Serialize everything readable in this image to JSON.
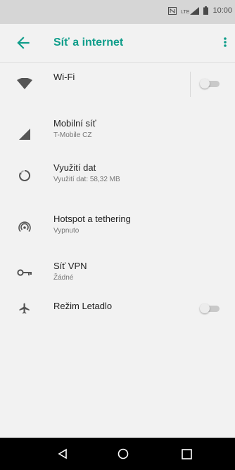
{
  "status_bar": {
    "time": "10:00",
    "lte_label": "LTE",
    "icons": [
      "nfc-icon",
      "lte-signal-icon",
      "battery-icon"
    ]
  },
  "header": {
    "title": "Síť a internet",
    "back_icon": "arrow-left-icon",
    "menu_icon": "more-vert-icon"
  },
  "items": [
    {
      "label": "Wi-Fi",
      "icon": "wifi-icon",
      "toggle": "off"
    },
    {
      "label": "Mobilní síť",
      "sublabel": "T-Mobile CZ",
      "icon": "cell-signal-icon"
    },
    {
      "label": "Využití dat",
      "sublabel": "Využití dat: 58,32 MB",
      "icon": "data-usage-icon"
    },
    {
      "label": "Hotspot a tethering",
      "sublabel": "Vypnuto",
      "icon": "hotspot-icon"
    },
    {
      "label": "Síť VPN",
      "sublabel": "Žádné",
      "icon": "vpn-key-icon"
    },
    {
      "label": "Režim Letadlo",
      "icon": "airplane-icon",
      "toggle": "off"
    }
  ],
  "nav": {
    "back_icon": "nav-back-icon",
    "home_icon": "nav-home-icon",
    "recents_icon": "nav-recents-icon"
  },
  "colors": {
    "accent": "#0f9d8a",
    "icon_gray": "#555555",
    "nav_bg": "#000000"
  }
}
